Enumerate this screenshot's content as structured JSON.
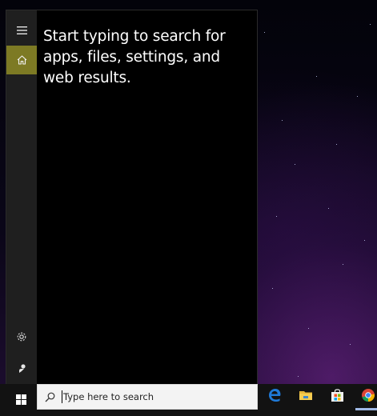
{
  "desktop": {
    "background": "starfield-purple"
  },
  "search_panel": {
    "hint_text": "Start typing to search for apps, files, settings, and web results.",
    "rail": {
      "menu_icon": "hamburger-icon",
      "home_icon": "home-icon",
      "settings_icon": "gear-icon",
      "feedback_icon": "feedback-icon"
    },
    "accent_color": "#7d7a24"
  },
  "taskbar": {
    "start_icon": "windows-logo-icon",
    "search_placeholder": "Type here to search",
    "pinned_apps": [
      "edge",
      "file-explorer",
      "microsoft-store",
      "chrome"
    ],
    "background": "#121212"
  }
}
